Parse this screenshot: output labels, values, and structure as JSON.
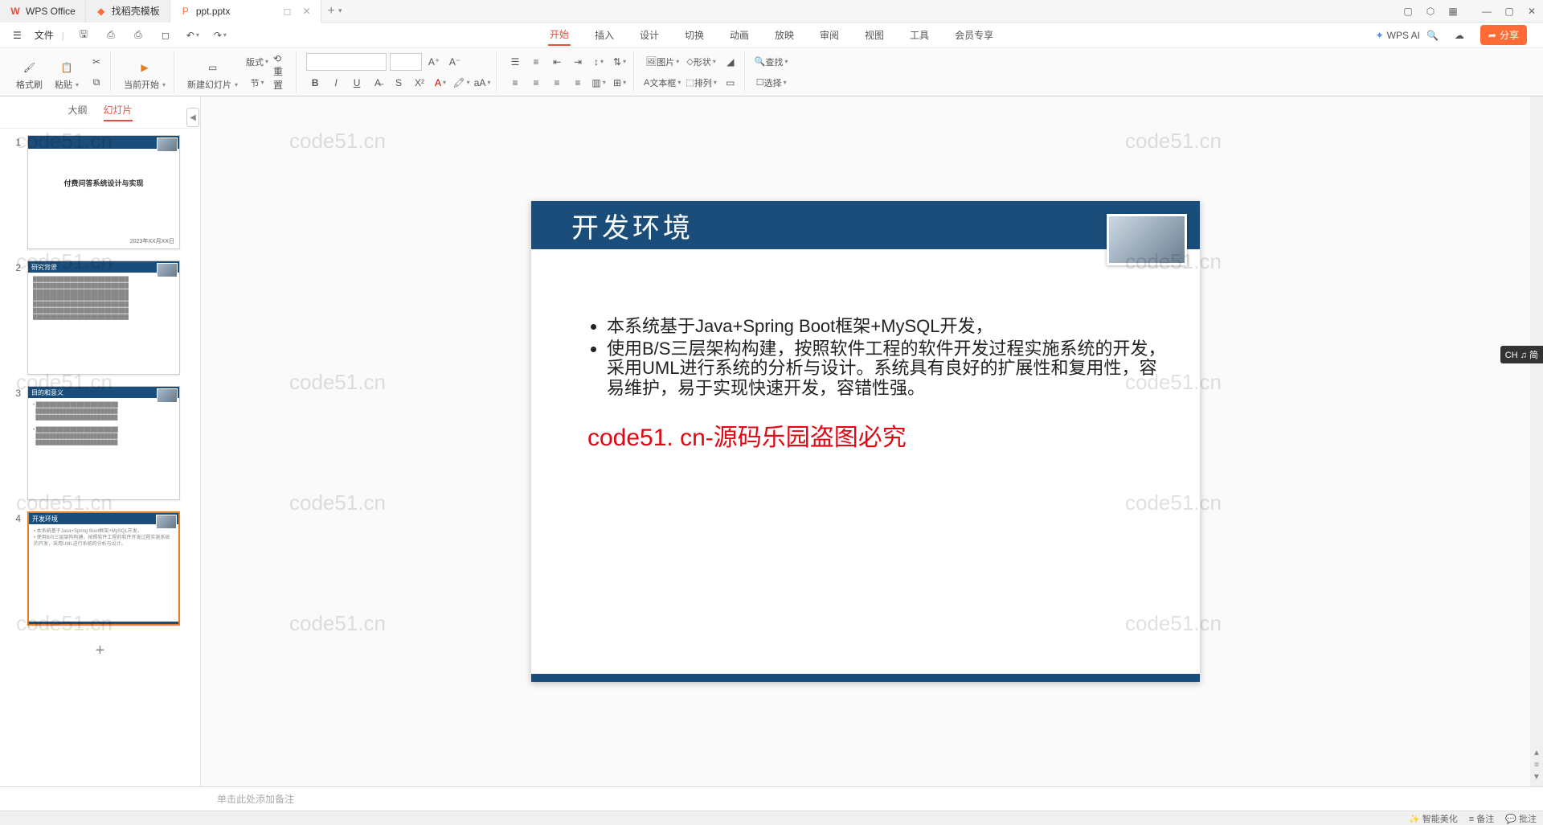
{
  "titlebar": {
    "tabs": [
      {
        "icon": "W",
        "label": "WPS Office"
      },
      {
        "icon": "◆",
        "label": "找稻壳模板"
      },
      {
        "icon": "P",
        "label": "ppt.pptx"
      }
    ],
    "add": "+"
  },
  "menubar": {
    "file": "文件",
    "tabs": [
      "开始",
      "插入",
      "设计",
      "切换",
      "动画",
      "放映",
      "审阅",
      "视图",
      "工具",
      "会员专享"
    ],
    "active_tab": 0,
    "wps_ai": "WPS AI",
    "share": "分享"
  },
  "ribbon": {
    "format_painter": "格式刷",
    "paste": "粘贴",
    "current_page": "当前开始",
    "new_slide": "新建幻灯片",
    "layouts": "版式",
    "sections": "节",
    "image": "图片",
    "shape": "形状",
    "textbox": "文本框",
    "arrange": "排列",
    "find": "查找",
    "select": "选择"
  },
  "sidepanel": {
    "tabs": [
      "大纲",
      "幻灯片"
    ],
    "active": 1,
    "thumbs": [
      {
        "num": "1",
        "title": "付费问答系统设计与实现",
        "footer": "2023年XX月XX日",
        "type": "title"
      },
      {
        "num": "2",
        "title": "研究背景",
        "type": "content"
      },
      {
        "num": "3",
        "title": "目的和意义",
        "type": "content"
      },
      {
        "num": "4",
        "title": "开发环境",
        "type": "content",
        "selected": true
      }
    ]
  },
  "slide": {
    "title": "开发环境",
    "bullets": [
      "本系统基于Java+Spring Boot框架+MySQL开发，",
      "使用B/S三层架构构建，按照软件工程的软件开发过程实施系统的开发，采用UML进行系统的分析与设计。系统具有良好的扩展性和复用性，容易维护，易于实现快速开发，容错性强。"
    ],
    "red_text": "code51. cn-源码乐园盗图必究"
  },
  "notes": "单击此处添加备注",
  "watermark": "code51.cn",
  "ime": "CH ♫ 简",
  "statusbar": {
    "right": [
      "智能美化",
      "备注",
      "批注"
    ]
  }
}
